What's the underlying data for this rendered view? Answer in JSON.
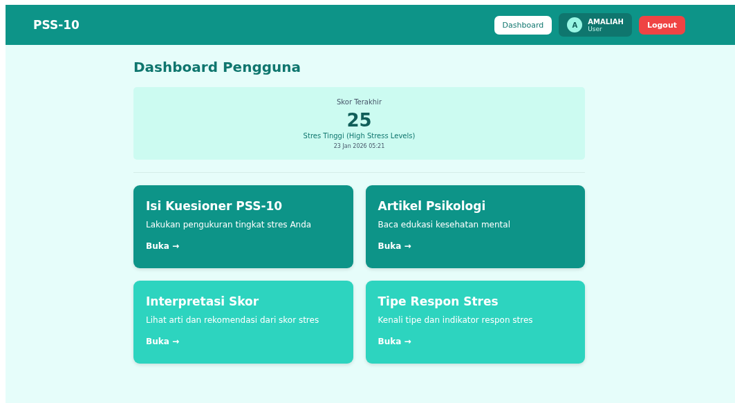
{
  "navbar": {
    "brand": "PSS-10",
    "nav_button": "Dashboard",
    "user": {
      "initial": "A",
      "name": "AMALIAH",
      "role": "User"
    },
    "logout_button": "Logout"
  },
  "page_title": "Dashboard Pengguna",
  "score_card": {
    "label": "Skor Terakhir",
    "score": "25",
    "category": "Stres Tinggi (High Stress Levels)",
    "date": "23 Jan 2026 05:21"
  },
  "menu_cards": [
    {
      "title": "Isi Kuesioner PSS-10",
      "description": "Lakukan pengukuran tingkat stres Anda",
      "link": "Buka →",
      "color": "#0d9488"
    },
    {
      "title": "Artikel Psikologi",
      "description": "Baca edukasi kesehatan mental",
      "link": "Buka →",
      "color": "#0d9488"
    },
    {
      "title": "Interpretasi Skor",
      "description": "Lihat arti dan rekomendasi dari skor stres",
      "link": "Buka →",
      "color": "#2dd4bf"
    },
    {
      "title": "Tipe Respon Stres",
      "description": "Kenali tipe dan indikator respon stres",
      "link": "Buka →",
      "color": "#2dd4bf"
    }
  ]
}
